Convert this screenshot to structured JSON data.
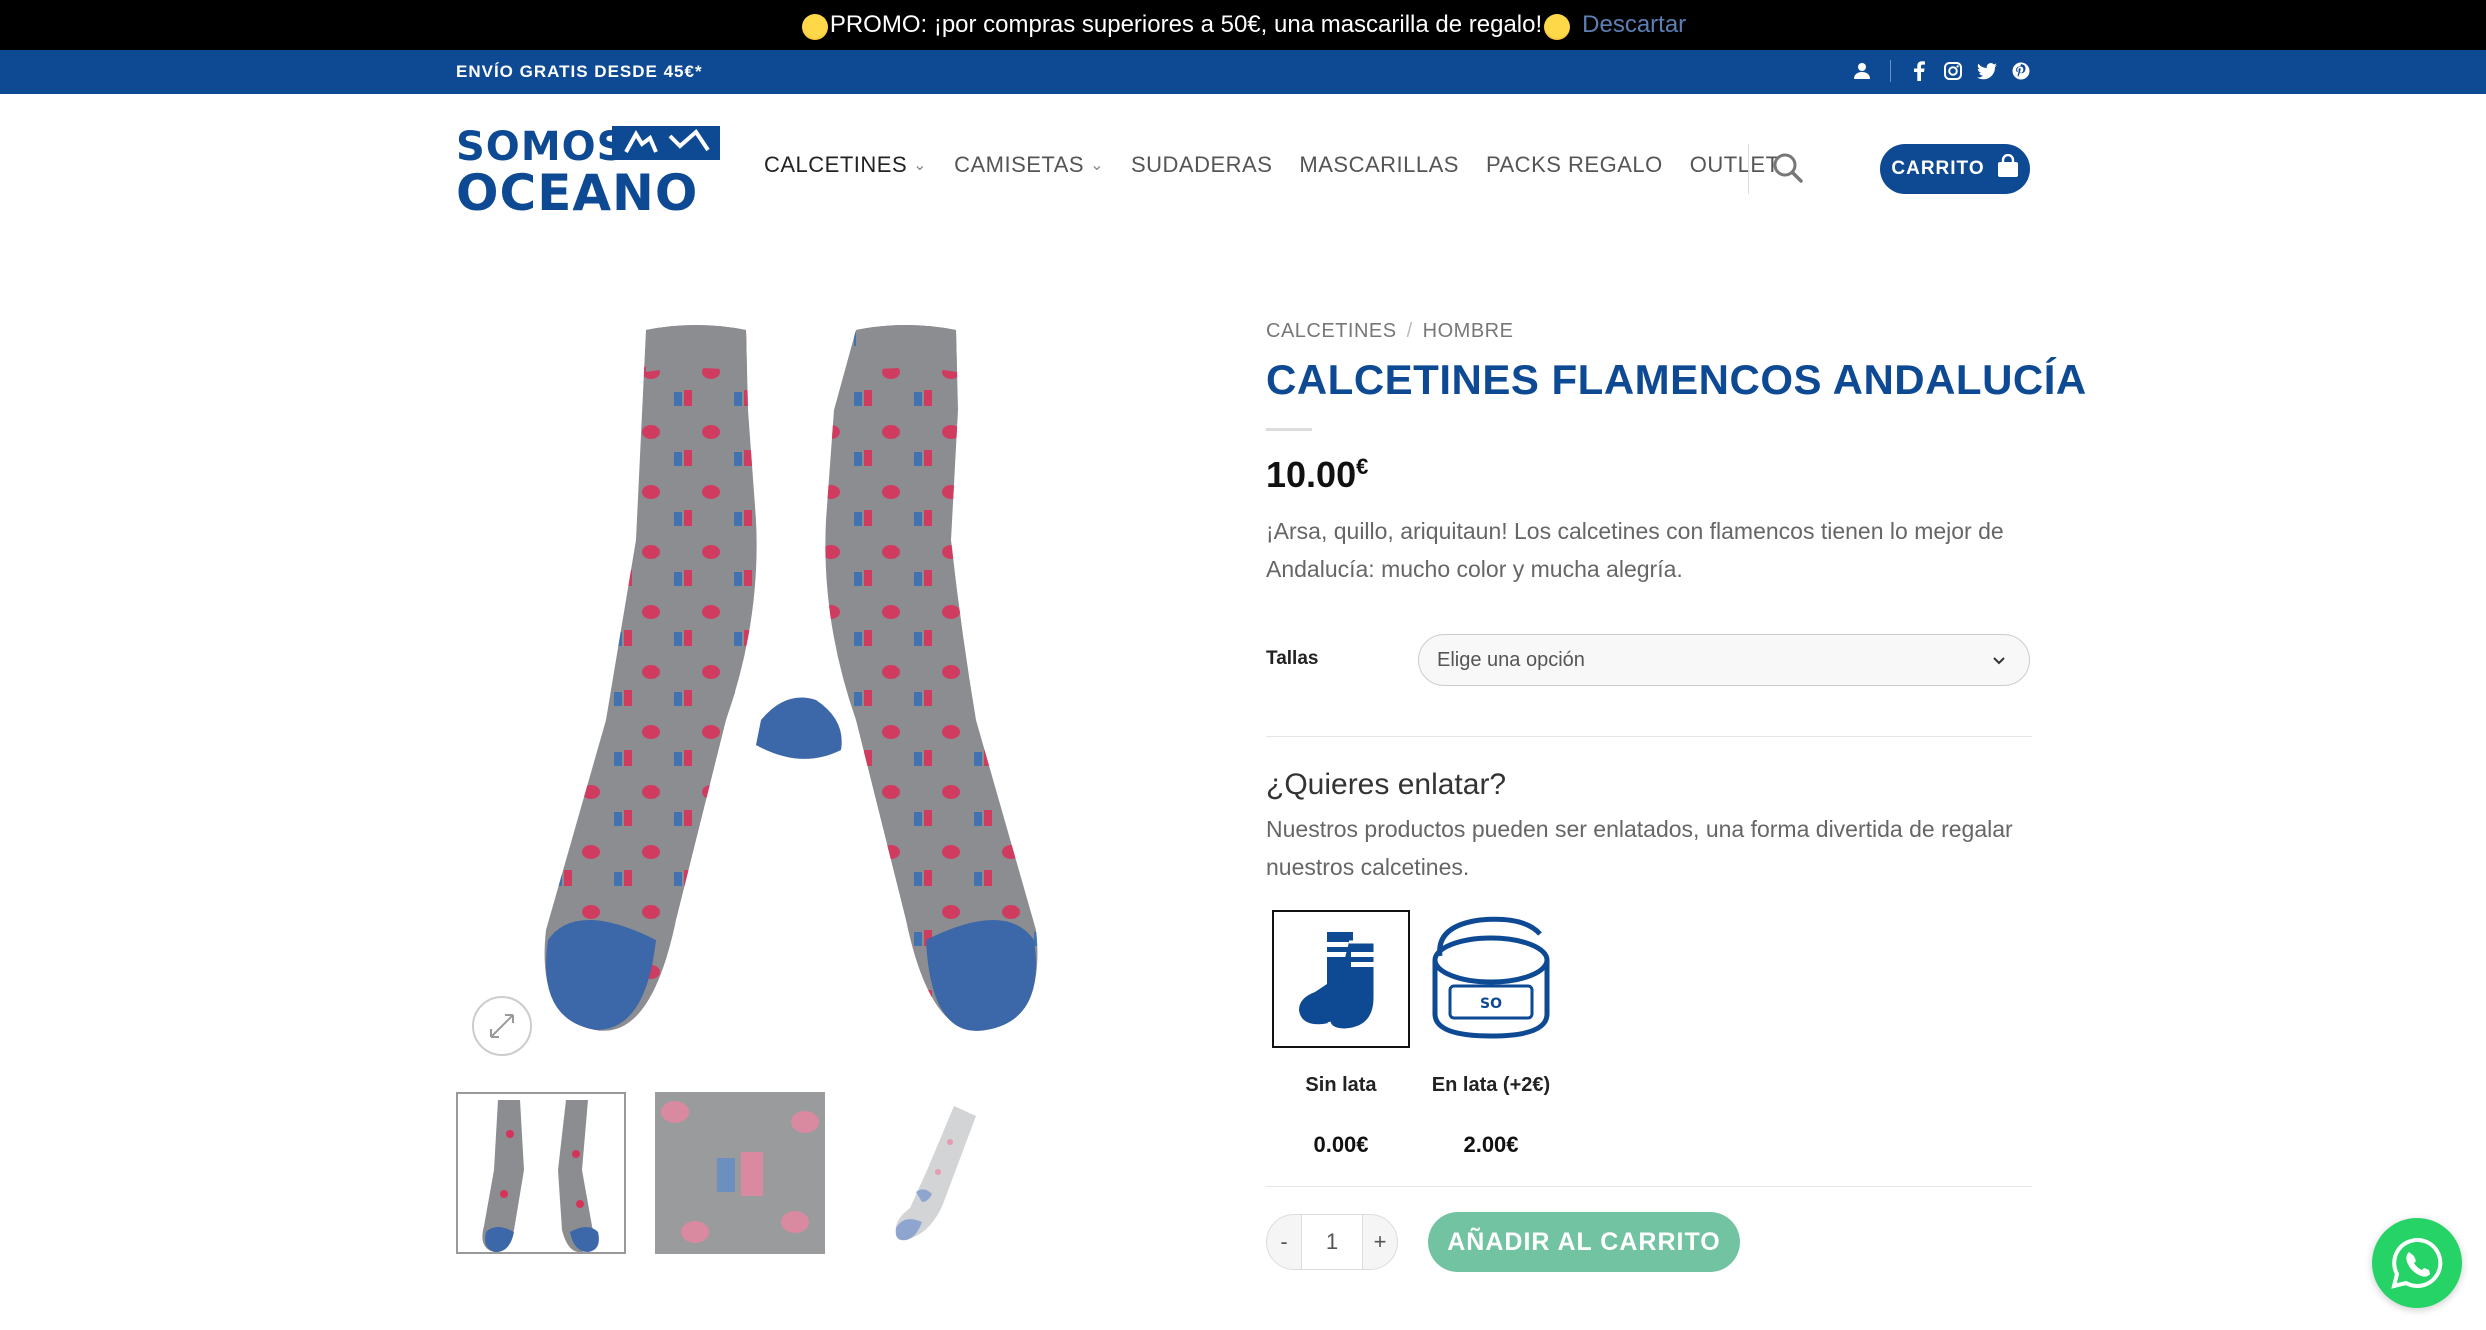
{
  "promo": {
    "text": "PROMO: ¡por compras superiores a 50€, una mascarilla de regalo!",
    "dismiss": "Descartar"
  },
  "topbar": {
    "shipping": "ENVÍO GRATIS DESDE 45€*"
  },
  "logo": {
    "line1": "SOMOS",
    "line2": "OCEANO"
  },
  "nav": {
    "items": [
      {
        "label": "CALCETINES"
      },
      {
        "label": "CAMISETAS"
      },
      {
        "label": "SUDADERAS"
      },
      {
        "label": "MASCARILLAS"
      },
      {
        "label": "PACKS REGALO"
      },
      {
        "label": "OUTLET"
      }
    ],
    "cart_label": "CARRITO"
  },
  "breadcrumb": [
    "CALCETINES",
    "HOMBRE"
  ],
  "product": {
    "title": "CALCETINES FLAMENCOS ANDALUCÍA",
    "price": "10.00",
    "currency": "€",
    "description": "¡Arsa, quillo, ariquitaun! Los calcetines con flamencos tienen lo mejor de Andalucía: mucho color y mucha alegría."
  },
  "variation": {
    "label": "Tallas",
    "placeholder": "Elige una opción"
  },
  "addon": {
    "title": "¿Quieres enlatar?",
    "description": "Nuestros productos pueden ser enlatados, una forma divertida de regalar nuestros calcetines.",
    "options": [
      {
        "label": "Sin lata",
        "price": "0.00€"
      },
      {
        "label": "En lata (+2€)",
        "price": "2.00€"
      }
    ]
  },
  "cart": {
    "quantity": "1",
    "minus": "-",
    "plus": "+",
    "add_label": "AÑADIR AL CARRITO"
  },
  "colors": {
    "brand_blue": "#0e4a94",
    "add_to_cart": "#72c3a2",
    "whatsapp": "#25d366"
  }
}
